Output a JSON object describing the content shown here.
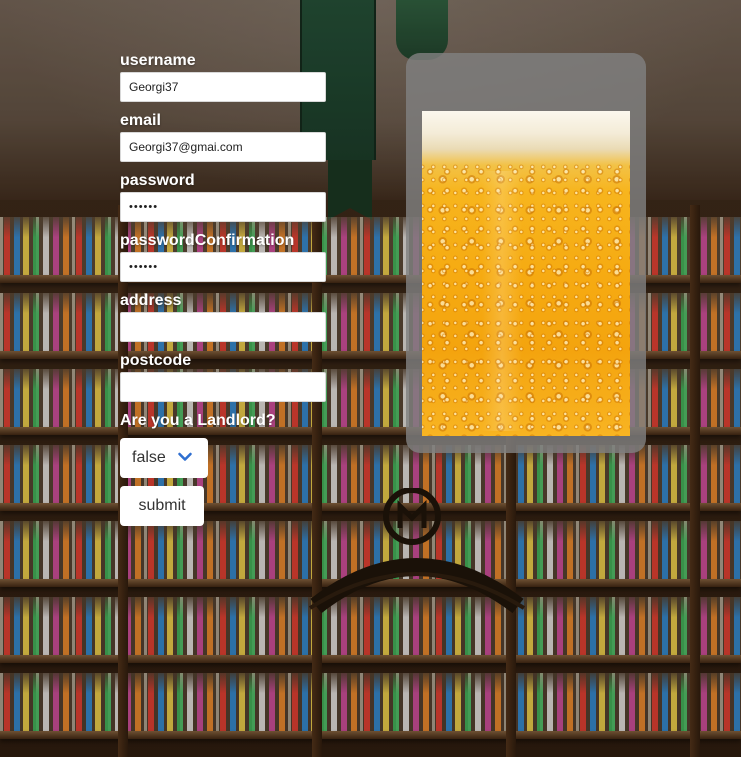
{
  "form": {
    "username": {
      "label": "username",
      "value": "Georgi37"
    },
    "email": {
      "label": "email",
      "value": "Georgi37@gmai.com"
    },
    "password": {
      "label": "password",
      "value": "••••••"
    },
    "password_confirmation": {
      "label": "passwordConfirmation",
      "value": "••••••"
    },
    "address": {
      "label": "address",
      "value": ""
    },
    "postcode": {
      "label": "postcode",
      "value": ""
    },
    "landlord": {
      "label": "Are you a Landlord?",
      "selected": "false"
    },
    "submit_label": "submit"
  },
  "image_card": {
    "image": "beer-glass",
    "background": "#808080"
  },
  "background": {
    "image": "bar-shelves-with-bottles"
  },
  "colors": {
    "label_text": "#ffffff",
    "select_chevron": "#2f6fd0"
  }
}
